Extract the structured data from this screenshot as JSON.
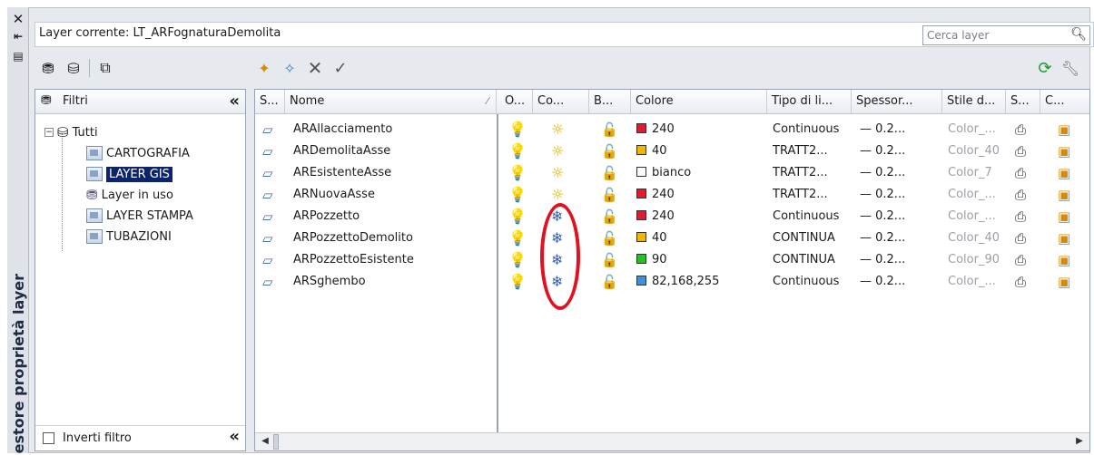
{
  "panel_label": "estore proprietà layer",
  "current_layer": "Layer corrente: LT_ARFognaturaDemolita",
  "search_placeholder": "Cerca layer",
  "filters": {
    "header": "Filtri",
    "items": [
      {
        "label": "Tutti"
      },
      {
        "label": "CARTOGRAFIA"
      },
      {
        "label": "LAYER GIS",
        "selected": true
      },
      {
        "label": "Layer in uso"
      },
      {
        "label": "LAYER STAMPA"
      },
      {
        "label": "TUBAZIONI"
      }
    ],
    "invert_label": "Inverti filtro",
    "collapse_glyph": "«"
  },
  "columns": {
    "s": "S...",
    "nome": "Nome",
    "o": "O...",
    "co": "Co...",
    "b": "B...",
    "colore": "Colore",
    "tipo": "Tipo di li...",
    "spessore": "Spessor...",
    "stile": "Stile d...",
    "s2": "S...",
    "c": "C..."
  },
  "layers": [
    {
      "name": "ARAllacciamento",
      "frozen": false,
      "color_hex": "#e01b2c",
      "color": "240",
      "linetype": "Continuous",
      "lineweight": "— 0.2...",
      "plotstyle": "Color_..."
    },
    {
      "name": "ARDemolitaAsse",
      "frozen": false,
      "color_hex": "#f2b600",
      "color": "40",
      "linetype": "TRATT2...",
      "lineweight": "— 0.2...",
      "plotstyle": "Color_40"
    },
    {
      "name": "AREsistenteAsse",
      "frozen": false,
      "color_hex": "#ffffff",
      "color": "bianco",
      "linetype": "TRATT2...",
      "lineweight": "— 0.2...",
      "plotstyle": "Color_7"
    },
    {
      "name": "ARNuovaAsse",
      "frozen": false,
      "color_hex": "#e01b2c",
      "color": "240",
      "linetype": "TRATT2...",
      "lineweight": "— 0.2...",
      "plotstyle": "Color_..."
    },
    {
      "name": "ARPozzetto",
      "frozen": true,
      "color_hex": "#e01b2c",
      "color": "240",
      "linetype": "Continuous",
      "lineweight": "— 0.2...",
      "plotstyle": "Color_..."
    },
    {
      "name": "ARPozzettoDemolito",
      "frozen": true,
      "color_hex": "#f2b600",
      "color": "40",
      "linetype": "CONTINUA",
      "lineweight": "— 0.2...",
      "plotstyle": "Color_40"
    },
    {
      "name": "ARPozzettoEsistente",
      "frozen": true,
      "color_hex": "#1fc51f",
      "color": "90",
      "linetype": "CONTINUA",
      "lineweight": "— 0.2...",
      "plotstyle": "Color_90"
    },
    {
      "name": "ARSghembo",
      "frozen": true,
      "color_hex": "#3f8fe0",
      "color": "82,168,255",
      "linetype": "Continuous",
      "lineweight": "— 0.2...",
      "plotstyle": "Color_..."
    }
  ],
  "icons": {
    "on": "💡",
    "thaw": "☼",
    "freeze": "❄",
    "unlock": "🔓",
    "plot": "⎙",
    "newvp": "▣"
  }
}
